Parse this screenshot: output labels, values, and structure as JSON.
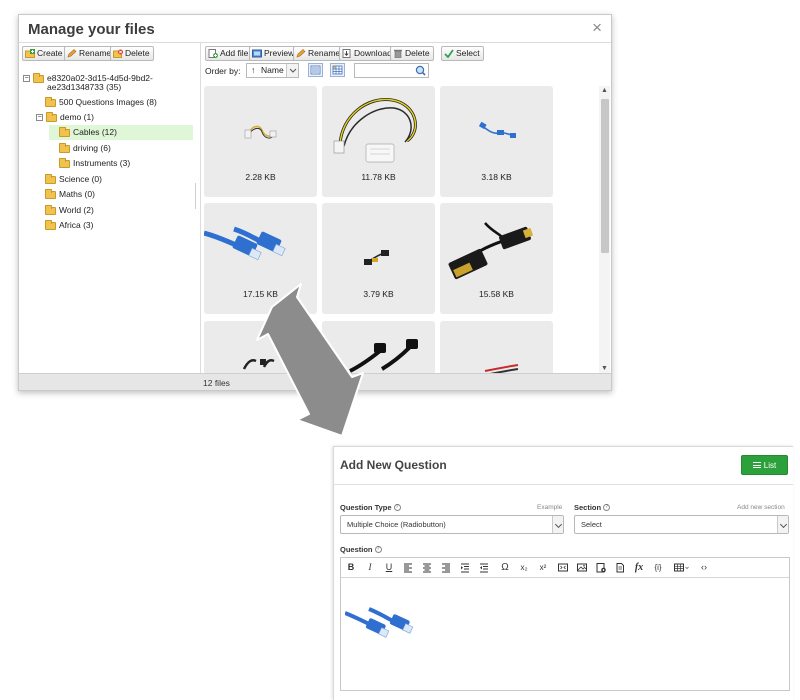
{
  "file_manager": {
    "title": "Manage your files",
    "close_icon": "×",
    "left_toolbar": {
      "create": "Create",
      "rename": "Rename",
      "delete": "Delete"
    },
    "right_toolbar": {
      "add_file": "Add file",
      "preview": "Preview",
      "rename": "Rename",
      "download": "Download",
      "delete": "Delete",
      "select": "Select"
    },
    "order_by_label": "Order by:",
    "order_by_value": "Name",
    "order_direction_icon": "↑",
    "search_value": "",
    "tree": {
      "root_line1": "e8320a02-3d15-4d5d-9bd2-",
      "root_line2": "ae23d1348733 (35)",
      "items": [
        {
          "label": "500 Questions Images (8)"
        },
        {
          "label": "demo (1)"
        },
        {
          "label": "Cables (12)"
        },
        {
          "label": "driving (6)"
        },
        {
          "label": "Instruments (3)"
        },
        {
          "label": "Science (0)"
        },
        {
          "label": "Maths (0)"
        },
        {
          "label": "World (2)"
        },
        {
          "label": "Africa (3)"
        }
      ]
    },
    "tiles": [
      {
        "size": "2.28 KB",
        "icon": "small-power-cable-icon"
      },
      {
        "size": "11.78 KB",
        "icon": "molex-power-cable-icon"
      },
      {
        "size": "3.18 KB",
        "icon": "small-network-cable-icon"
      },
      {
        "size": "17.15 KB",
        "icon": "network-cable-icon"
      },
      {
        "size": "3.79 KB",
        "icon": "small-display-cable-icon"
      },
      {
        "size": "15.58 KB",
        "icon": "displayport-dvi-cable-icon"
      },
      {
        "size": "",
        "icon": "partial-cable-icon"
      },
      {
        "size": "",
        "icon": "partial-cable-icon"
      },
      {
        "size": "",
        "icon": "partial-cable-icon"
      }
    ],
    "status": "12 files"
  },
  "add_question": {
    "title": "Add New Question",
    "list_button": "List",
    "question_type_label": "Question Type",
    "example_link": "Example",
    "question_type_value": "Multiple Choice (Radiobutton)",
    "section_label": "Section",
    "add_section_link": "Add new section",
    "section_value": "Select",
    "question_label": "Question",
    "editor_buttons": {
      "bold": "B",
      "italic": "I",
      "underline": "U",
      "omega": "Ω",
      "subscript": "x₂",
      "superscript": "x²",
      "formula": "fx",
      "placeholder": "{i}",
      "code": "‹›"
    }
  },
  "colors": {
    "tile_bg": "#ebebeb",
    "selected_folder_bg": "#dff7d6",
    "list_button": "#2ca13b",
    "folder": "#f2c24f",
    "cable_blue": "#2f6fd0",
    "arrow_gray": "#8c8c8c"
  }
}
